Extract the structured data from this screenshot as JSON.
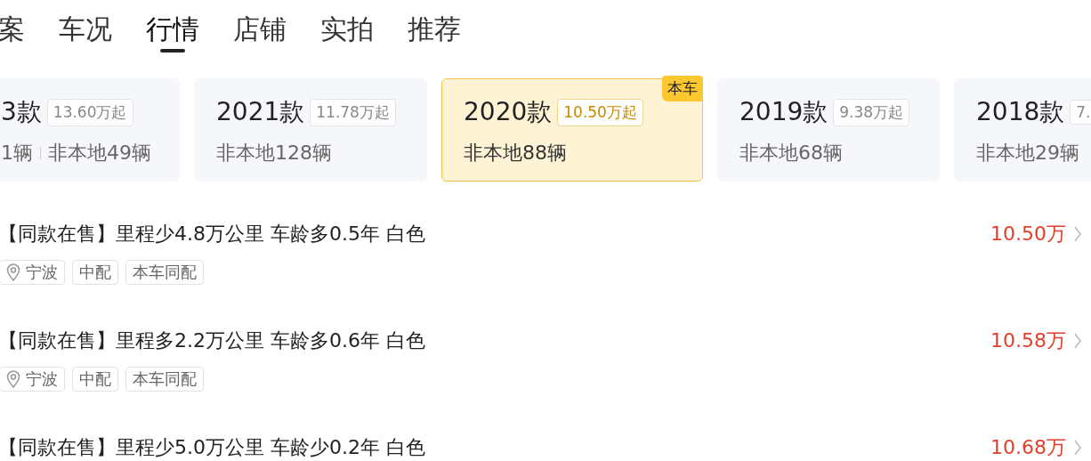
{
  "tabs": [
    {
      "label": "案",
      "selected": false
    },
    {
      "label": "车况",
      "selected": false
    },
    {
      "label": "行情",
      "selected": true
    },
    {
      "label": "店铺",
      "selected": false
    },
    {
      "label": "实拍",
      "selected": false
    },
    {
      "label": "推荐",
      "selected": false
    }
  ],
  "model_cards": [
    {
      "year": "3款",
      "price": "13.60万起",
      "counts": [
        "1辆",
        "非本地49辆"
      ],
      "selected": false
    },
    {
      "year": "2021款",
      "price": "11.78万起",
      "counts": [
        "非本地128辆"
      ],
      "selected": false
    },
    {
      "year": "2020款",
      "price": "10.50万起",
      "counts": [
        "非本地88辆"
      ],
      "selected": true,
      "badge": "本车"
    },
    {
      "year": "2019款",
      "price": "9.38万起",
      "counts": [
        "非本地68辆"
      ],
      "selected": false
    },
    {
      "year": "2018款",
      "price": "7.",
      "counts": [
        "非本地29辆"
      ],
      "selected": false
    }
  ],
  "listings": [
    {
      "title": "【同款在售】里程少4.8万公里 车龄多0.5年 白色",
      "price": "10.50万",
      "tags": [
        {
          "kind": "location",
          "text": "宁波"
        },
        {
          "kind": "plain",
          "text": "中配"
        },
        {
          "kind": "plain",
          "text": "本车同配"
        }
      ]
    },
    {
      "title": "【同款在售】里程多2.2万公里 车龄多0.6年 白色",
      "price": "10.58万",
      "tags": [
        {
          "kind": "location",
          "text": "宁波"
        },
        {
          "kind": "plain",
          "text": "中配"
        },
        {
          "kind": "plain",
          "text": "本车同配"
        }
      ]
    },
    {
      "title": "【同款在售】里程少5.0万公里 车龄少0.2年 白色",
      "price": "10.68万"
    }
  ]
}
